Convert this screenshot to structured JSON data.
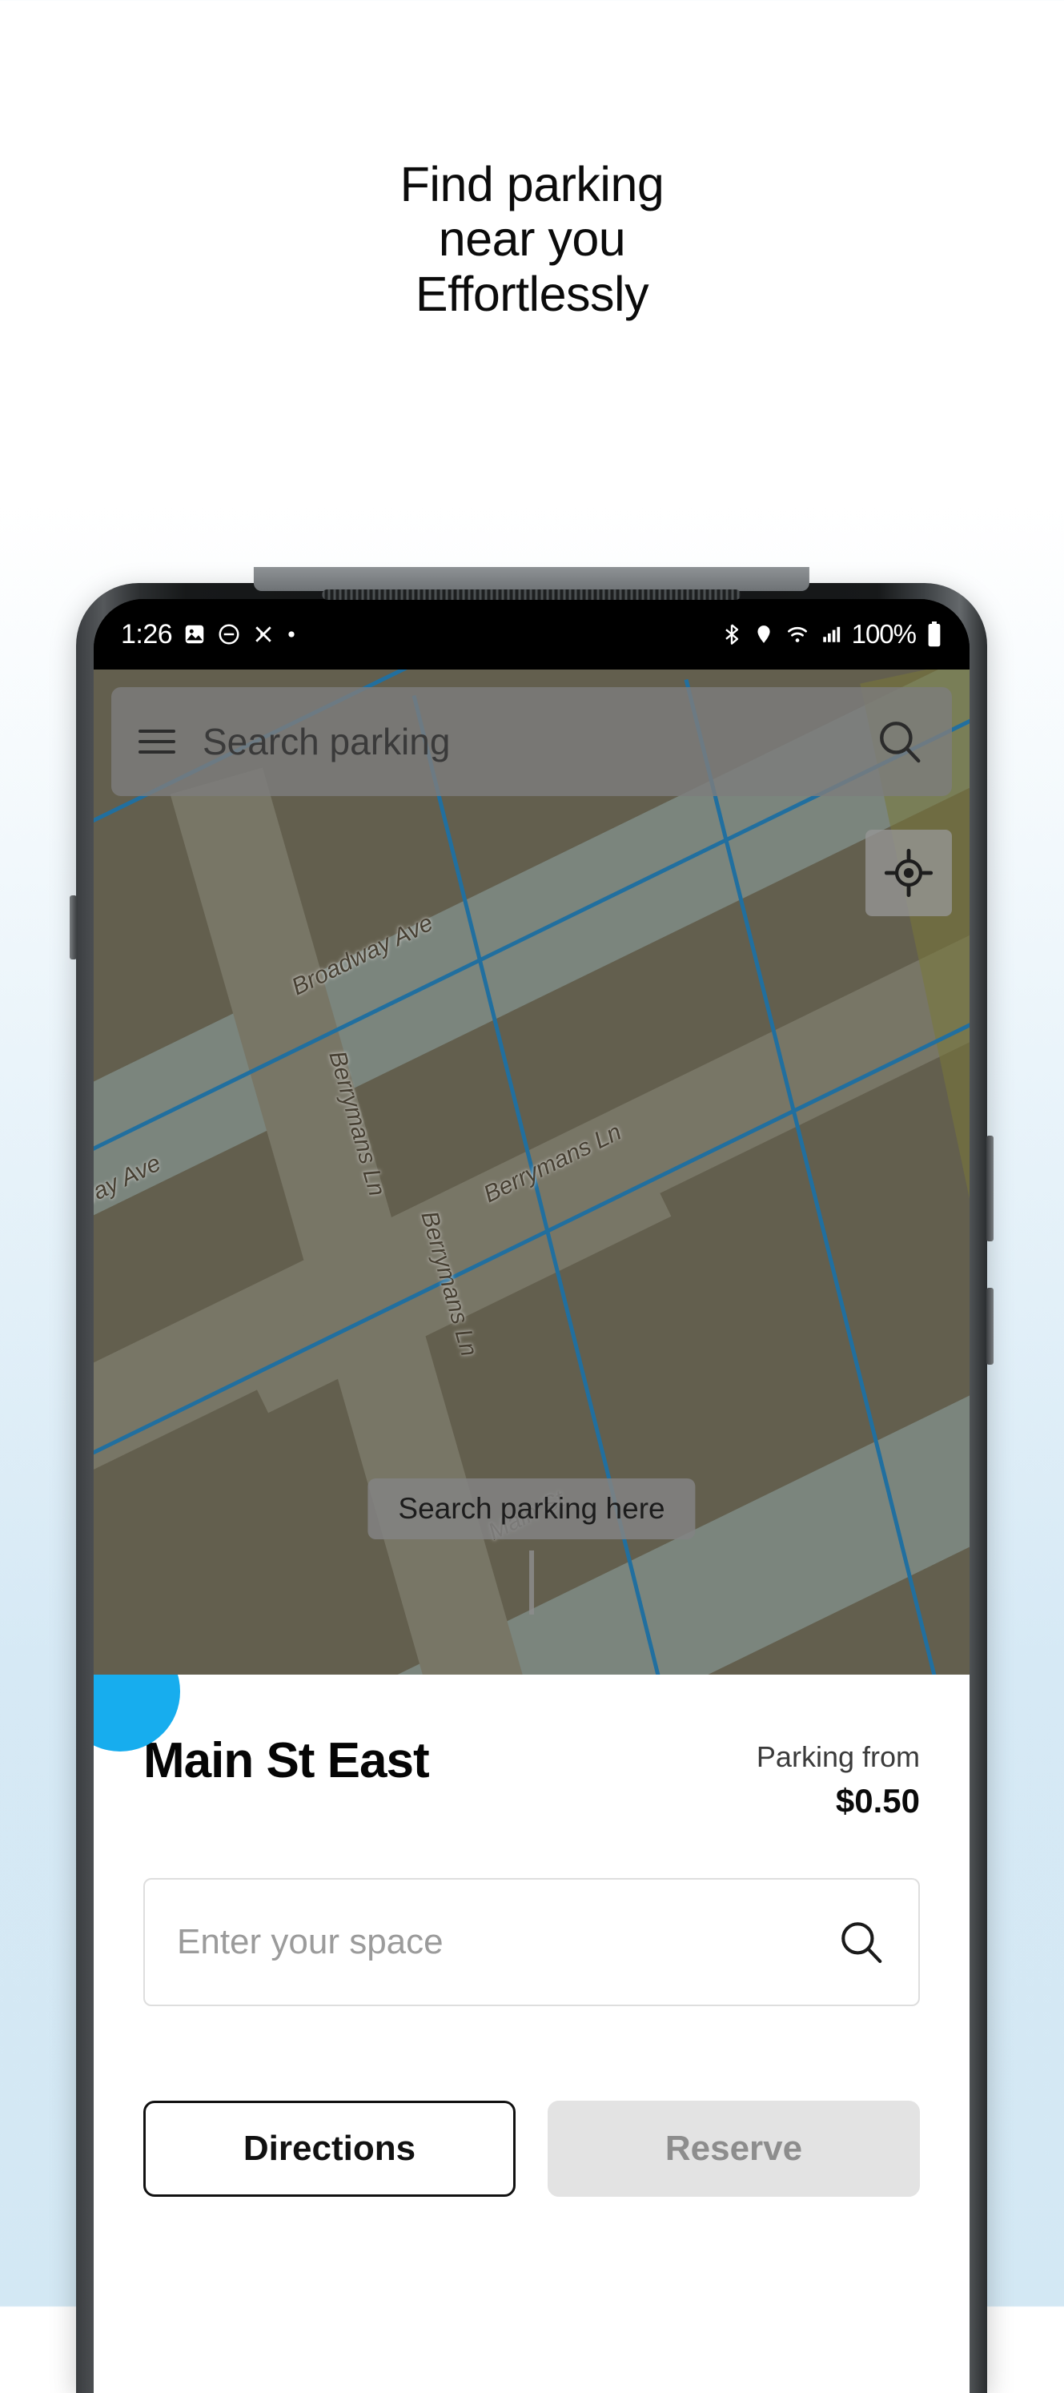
{
  "hero": {
    "line1": "Find parking",
    "line2": "near you",
    "line3": "Effortlessly"
  },
  "phone": {
    "status_bar": {
      "time": "1:26",
      "left_icons": [
        "image-icon",
        "do-not-disturb-icon",
        "mute-icon",
        "dot-icon"
      ],
      "right_icons": [
        "bluetooth-icon",
        "location-icon",
        "wifi-icon",
        "cellular-signal-icon"
      ],
      "battery_percent": "100%",
      "battery_icon": "battery-full-icon"
    },
    "map_screen": {
      "search_bar": {
        "menu_icon": "hamburger-menu-icon",
        "placeholder": "Search parking",
        "search_icon": "search-icon"
      },
      "locate_button_icon": "my-location-icon",
      "search_here_chip": "Search parking here",
      "street_labels": [
        "Broadway Ave",
        "Broadway Ave",
        "Berrymans Ln",
        "Berrymans Ln",
        "Berrymans Ln",
        "Main St"
      ]
    },
    "bottom_sheet": {
      "place_name": "Main St East",
      "price_label": "Parking from",
      "price_value": "$0.50",
      "space_input_placeholder": "Enter your space",
      "space_input_icon": "search-icon",
      "buttons": [
        {
          "label": "Directions",
          "style": "outline"
        },
        {
          "label": "Reserve",
          "style": "filled"
        }
      ]
    }
  },
  "colors": {
    "accent_blue": "#17ADEE",
    "map_lane_blue": "#1A7FC1",
    "background_blue": "#d3e8f4"
  }
}
